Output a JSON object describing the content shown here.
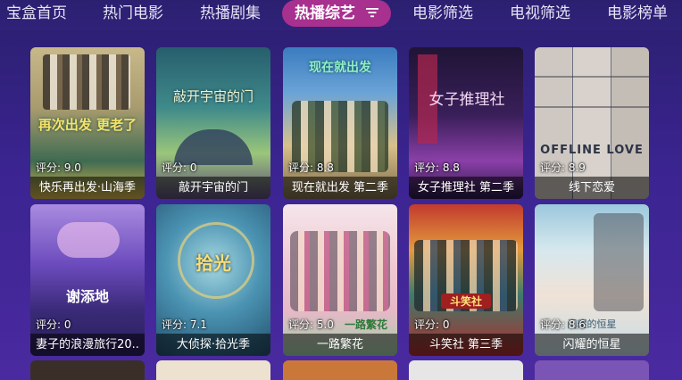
{
  "nav": {
    "tabs": [
      {
        "label": "宝盒首页"
      },
      {
        "label": "热门电影"
      },
      {
        "label": "热播剧集"
      },
      {
        "label": "热播综艺"
      },
      {
        "label": "电影筛选"
      },
      {
        "label": "电视筛选"
      },
      {
        "label": "电影榜单"
      }
    ],
    "active_index": 3
  },
  "score_prefix": "评分:",
  "cards": [
    {
      "title": "快乐再出发·山海季",
      "score": "评分: 9.0",
      "colors": [
        "#b8a57a",
        "#2f5f48"
      ],
      "poster_text": "再次出发 更老了"
    },
    {
      "title": "敲开宇宙的门",
      "score": "评分: 0",
      "colors": [
        "#2f6a78",
        "#b7cf8a"
      ],
      "poster_text": "敲开宇宙的门"
    },
    {
      "title": "现在就出发 第二季",
      "score": "评分: 8.8",
      "colors": [
        "#3d7ab8",
        "#e6c489"
      ],
      "poster_text": "现在就出发"
    },
    {
      "title": "女子推理社 第二季",
      "score": "评分: 8.8",
      "colors": [
        "#2a1a4a",
        "#7d3b9a"
      ],
      "poster_text": "女子推理社"
    },
    {
      "title": "线下恋爱",
      "score": "评分: 8.9",
      "colors": [
        "#d9d4d0",
        "#5a6170"
      ],
      "poster_text": "OFFLINE LOVE"
    },
    {
      "title": "妻子的浪漫旅行20..",
      "score": "评分: 0",
      "colors": [
        "#4b2e8f",
        "#c1a6e6"
      ],
      "poster_text": "谢添地"
    },
    {
      "title": "大侦探·拾光季",
      "score": "评分: 7.1",
      "colors": [
        "#2a5d86",
        "#79bcd1"
      ],
      "poster_text": "拾光"
    },
    {
      "title": "一路繁花",
      "score": "评分: 5.0",
      "colors": [
        "#f1d6de",
        "#8fcf9a"
      ],
      "poster_text": "一路繁花"
    },
    {
      "title": "斗笑社 第三季",
      "score": "评分: 0",
      "colors": [
        "#b72b2b",
        "#e8b248"
      ],
      "poster_text": "斗笑社"
    },
    {
      "title": "闪耀的恒星",
      "score": "评分: 8.6",
      "colors": [
        "#7fb6cf",
        "#eedccf"
      ],
      "poster_text": "闪耀的恒星"
    }
  ],
  "partial_row_colors": [
    "#3a2f28",
    "#ece2cf",
    "#c9783a",
    "#e6e6e6",
    "#7a55b5"
  ]
}
